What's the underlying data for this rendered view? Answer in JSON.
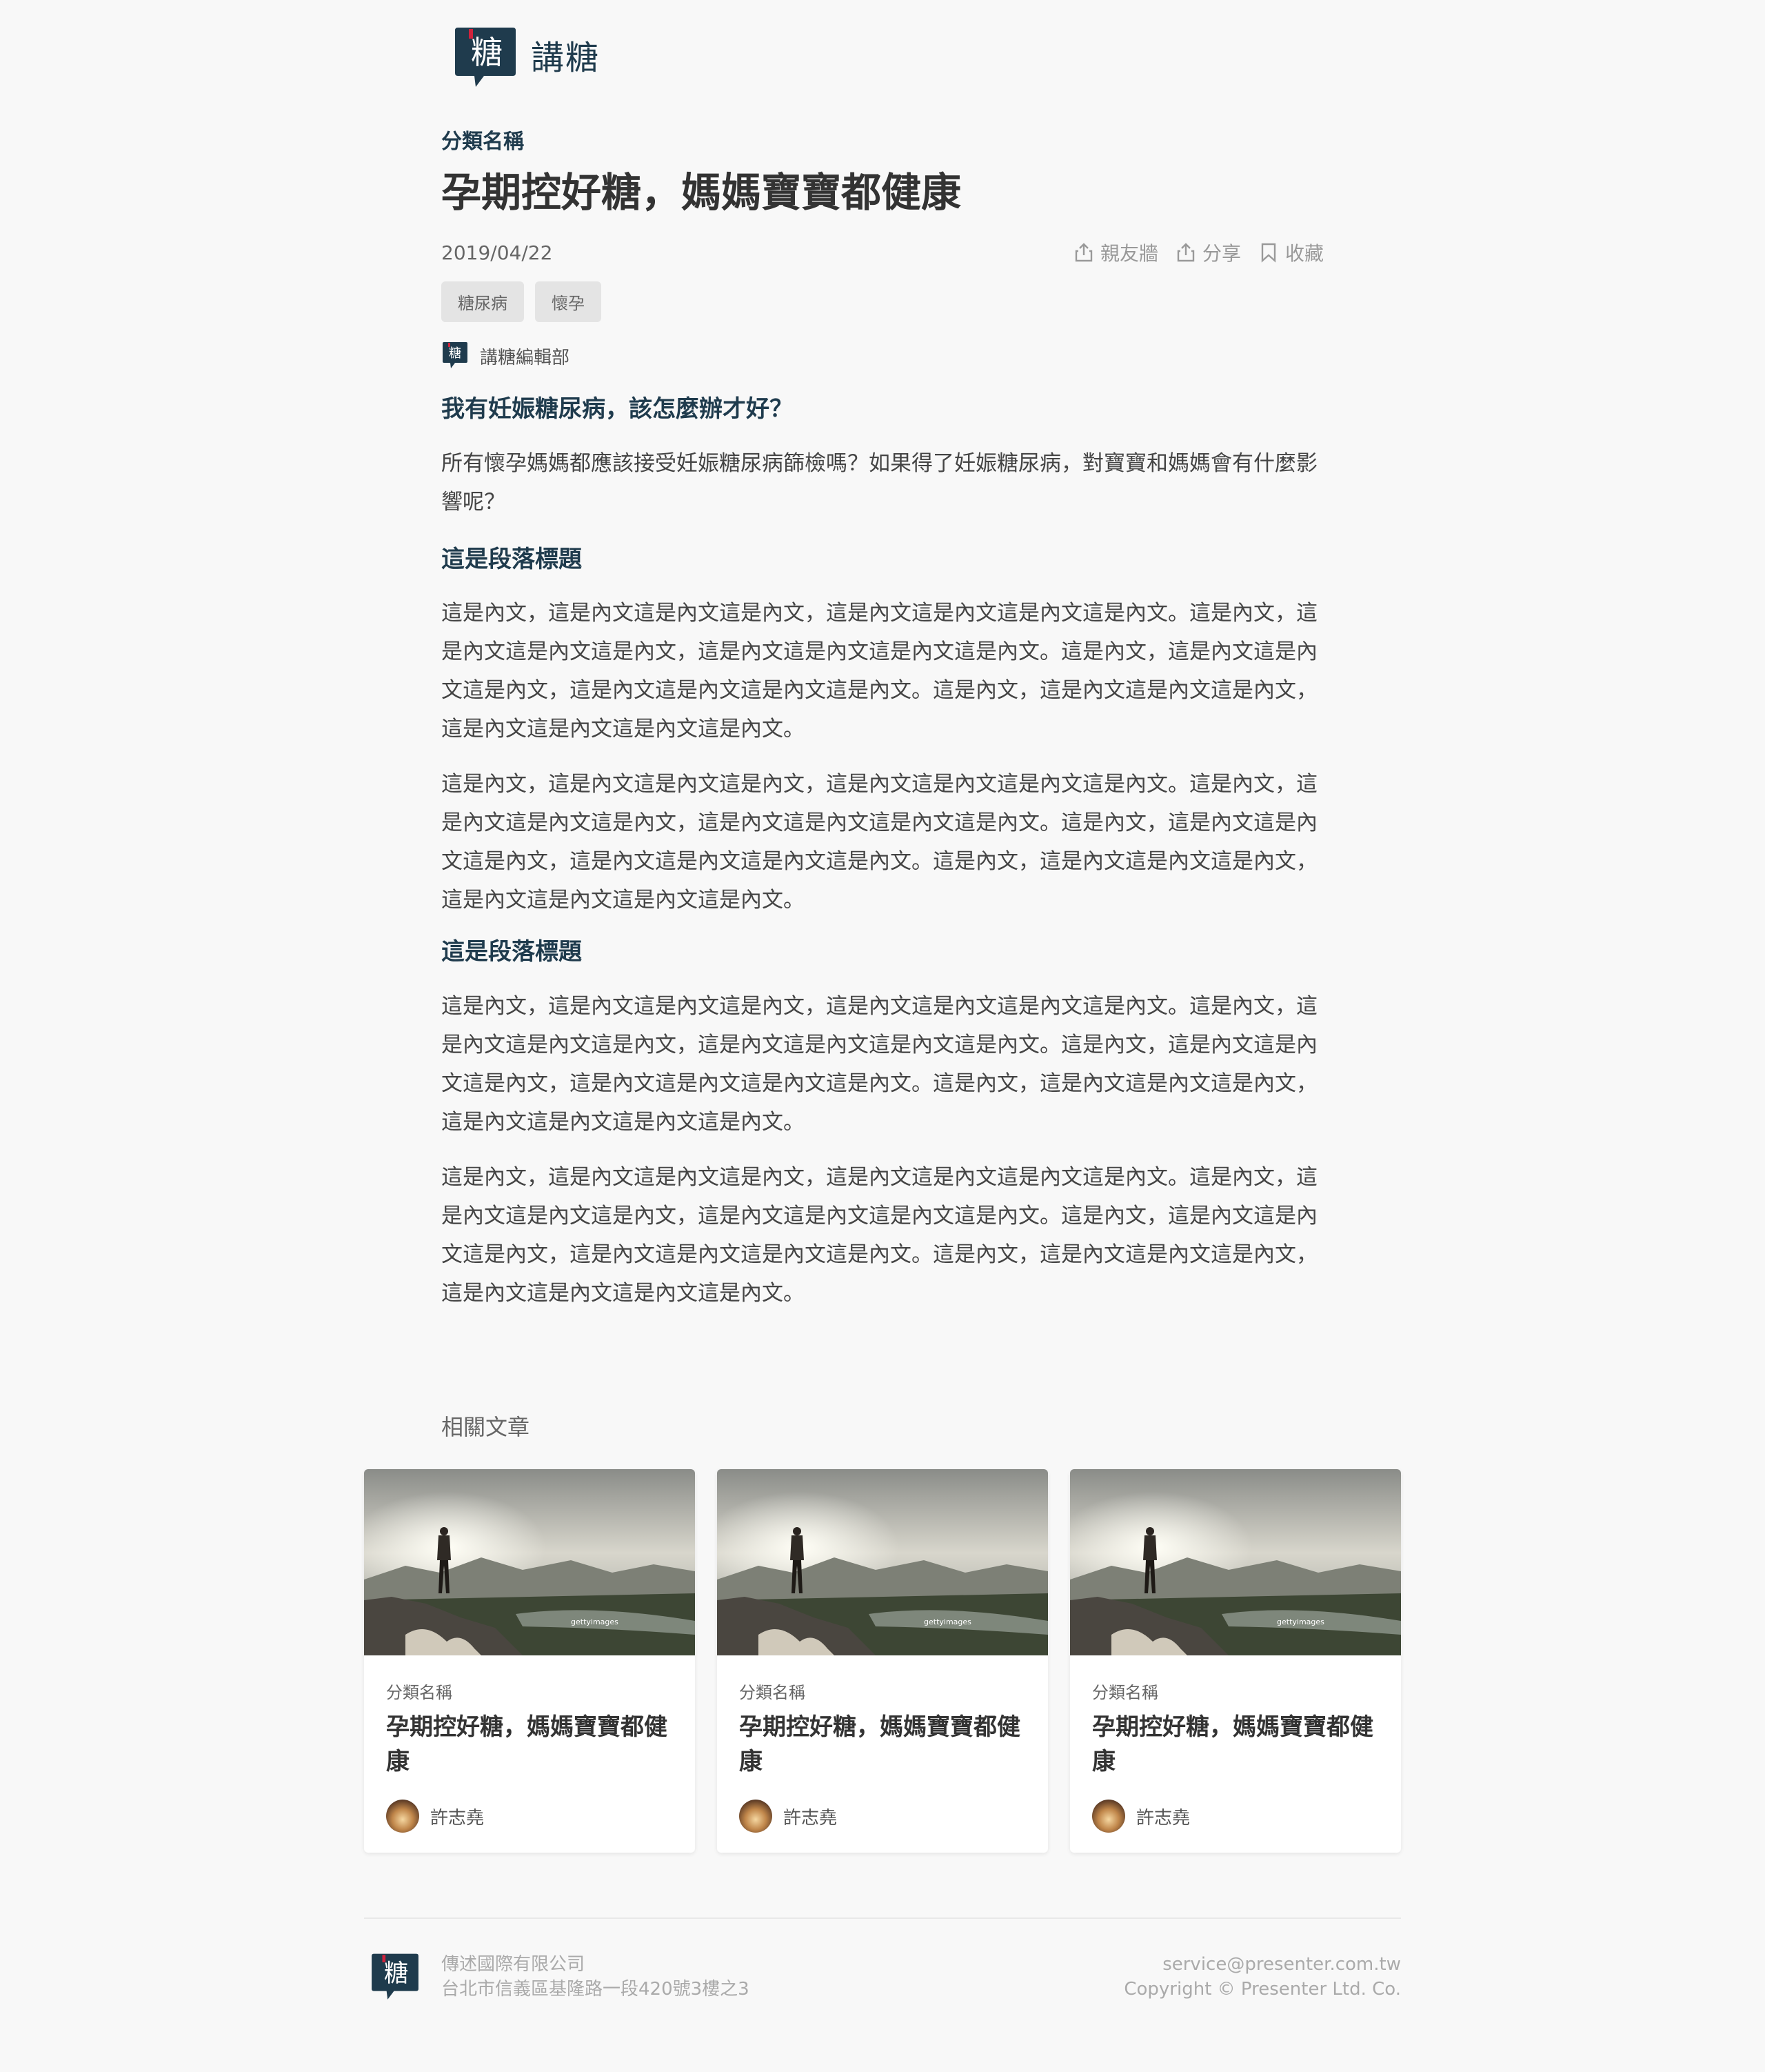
{
  "brand": {
    "logo_char": "糖",
    "name": "講糖"
  },
  "article": {
    "category": "分類名稱",
    "title": "孕期控好糖，媽媽寶寶都健康",
    "date": "2019/04/22",
    "actions": [
      {
        "label": "親友牆",
        "icon": "share-upload-icon"
      },
      {
        "label": "分享",
        "icon": "share-icon"
      },
      {
        "label": "收藏",
        "icon": "bookmark-icon"
      }
    ],
    "tags": [
      "糖尿病",
      "懷孕"
    ],
    "author": "講糖編輯部",
    "intro_heading": "我有妊娠糖尿病，該怎麼辦才好？",
    "intro_text": "所有懷孕媽媽都應該接受妊娠糖尿病篩檢嗎？如果得了妊娠糖尿病，對寶寶和媽媽會有什麼影響呢？",
    "sections": [
      {
        "heading": "這是段落標題",
        "paragraphs": [
          "這是內文，這是內文這是內文這是內文，這是內文這是內文這是內文這是內文。這是內文，這是內文這是內文這是內文，這是內文這是內文這是內文這是內文。這是內文，這是內文這是內文這是內文，這是內文這是內文這是內文這是內文。這是內文，這是內文這是內文這是內文，這是內文這是內文這是內文這是內文。",
          "這是內文，這是內文這是內文這是內文，這是內文這是內文這是內文這是內文。這是內文，這是內文這是內文這是內文，這是內文這是內文這是內文這是內文。這是內文，這是內文這是內文這是內文，這是內文這是內文這是內文這是內文。這是內文，這是內文這是內文這是內文，這是內文這是內文這是內文這是內文。"
        ]
      },
      {
        "heading": "這是段落標題",
        "paragraphs": [
          "這是內文，這是內文這是內文這是內文，這是內文這是內文這是內文這是內文。這是內文，這是內文這是內文這是內文，這是內文這是內文這是內文這是內文。這是內文，這是內文這是內文這是內文，這是內文這是內文這是內文這是內文。這是內文，這是內文這是內文這是內文，這是內文這是內文這是內文這是內文。",
          "這是內文，這是內文這是內文這是內文，這是內文這是內文這是內文這是內文。這是內文，這是內文這是內文這是內文，這是內文這是內文這是內文這是內文。這是內文，這是內文這是內文這是內文，這是內文這是內文這是內文這是內文。這是內文，這是內文這是內文這是內文，這是內文這是內文這是內文這是內文。"
        ]
      }
    ]
  },
  "related": {
    "title": "相關文章",
    "cards": [
      {
        "category": "分類名稱",
        "title": "孕期控好糖，媽媽寶寶都健康",
        "author": "許志堯",
        "watermark": "gettyimages"
      },
      {
        "category": "分類名稱",
        "title": "孕期控好糖，媽媽寶寶都健康",
        "author": "許志堯",
        "watermark": "gettyimages"
      },
      {
        "category": "分類名稱",
        "title": "孕期控好糖，媽媽寶寶都健康",
        "author": "許志堯",
        "watermark": "gettyimages"
      }
    ]
  },
  "footer": {
    "company": "傳述國際有限公司",
    "address": "台北市信義區基隆路一段420號3樓之3",
    "email": "service@presenter.com.tw",
    "copyright": "Copyright © Presenter Ltd. Co."
  },
  "colors": {
    "brand_navy": "#1f3b4d",
    "brand_red": "#d0223c",
    "background": "#f8f8f8"
  }
}
